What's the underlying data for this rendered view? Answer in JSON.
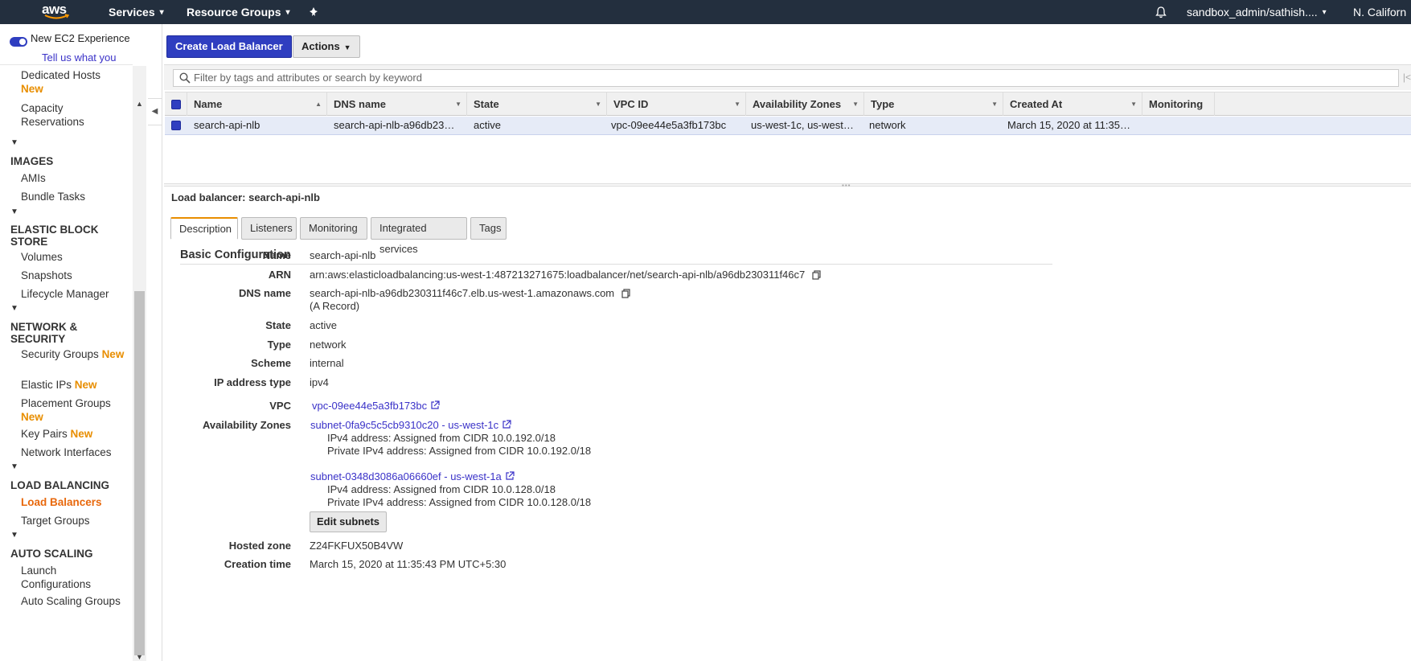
{
  "topbar": {
    "logo": "aws",
    "services": "Services",
    "resource_groups": "Resource Groups",
    "user": "sandbox_admin/sathish....",
    "region": "N. Californ"
  },
  "sidebar": {
    "toggle_label": "New EC2 Experience",
    "tell_us": "Tell us what you",
    "new_badge": "New",
    "items": {
      "dedicated_hosts": "Dedicated Hosts",
      "capacity_reservations": "Capacity Reservations",
      "images_head": "IMAGES",
      "amis": "AMIs",
      "bundle_tasks": "Bundle Tasks",
      "ebs_head": "ELASTIC BLOCK STORE",
      "volumes": "Volumes",
      "snapshots": "Snapshots",
      "lifecycle": "Lifecycle Manager",
      "netsec_head": "NETWORK & SECURITY",
      "security_groups": "Security Groups",
      "elastic_ips": "Elastic IPs",
      "placement_groups": "Placement Groups",
      "key_pairs": "Key Pairs",
      "network_interfaces": "Network Interfaces",
      "lb_head": "LOAD BALANCING",
      "load_balancers": "Load Balancers",
      "target_groups": "Target Groups",
      "as_head": "AUTO SCALING",
      "launch_configs": "Launch Configurations",
      "as_groups": "Auto Scaling Groups"
    }
  },
  "toolbar": {
    "create_label": "Create Load Balancer",
    "actions_label": "Actions"
  },
  "search": {
    "placeholder": "Filter by tags and attributes or search by keyword"
  },
  "table": {
    "headers": [
      "Name",
      "DNS name",
      "State",
      "VPC ID",
      "Availability Zones",
      "Type",
      "Created At",
      "Monitoring"
    ],
    "row": {
      "name": "search-api-nlb",
      "dns": "search-api-nlb-a96db23…",
      "state": "active",
      "vpc": "vpc-09ee44e5a3fb173bc",
      "azs": "us-west-1c, us-west…",
      "type": "network",
      "created": "March 15, 2020 at 11:35…",
      "monitoring": ""
    }
  },
  "detail": {
    "title_prefix": "Load balancer:",
    "title_name": "search-api-nlb",
    "tabs": [
      "Description",
      "Listeners",
      "Monitoring",
      "Integrated services",
      "Tags"
    ],
    "section": "Basic Configuration",
    "labels": {
      "name": "Name",
      "arn": "ARN",
      "dns": "DNS name",
      "state": "State",
      "type": "Type",
      "scheme": "Scheme",
      "ip_type": "IP address type",
      "vpc": "VPC",
      "azs": "Availability Zones",
      "hosted_zone": "Hosted zone",
      "creation_time": "Creation time"
    },
    "values": {
      "name": "search-api-nlb",
      "arn": "arn:aws:elasticloadbalancing:us-west-1:487213271675:loadbalancer/net/search-api-nlb/a96db230311f46c7",
      "dns": "search-api-nlb-a96db230311f46c7.elb.us-west-1.amazonaws.com",
      "dns_record": "(A Record)",
      "state": "active",
      "type": "network",
      "scheme": "internal",
      "ip_type": "ipv4",
      "vpc": "vpc-09ee44e5a3fb173bc",
      "subnet1": "subnet-0fa9c5c5cb9310c20 - us-west-1c",
      "subnet1_ipv4": "IPv4 address: Assigned from CIDR 10.0.192.0/18",
      "subnet1_private": "Private IPv4 address: Assigned from CIDR 10.0.192.0/18",
      "subnet2": "subnet-0348d3086a06660ef - us-west-1a",
      "subnet2_ipv4": "IPv4 address: Assigned from CIDR 10.0.128.0/18",
      "subnet2_private": "Private IPv4 address: Assigned from CIDR 10.0.128.0/18",
      "hosted_zone": "Z24FKFUX50B4VW",
      "creation_time": "March 15, 2020 at 11:35:43 PM UTC+5:30"
    },
    "edit_subnets": "Edit subnets"
  }
}
